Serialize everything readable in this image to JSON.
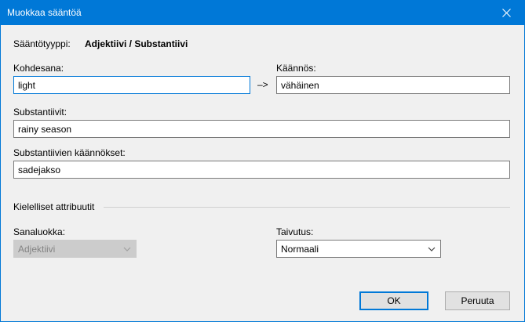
{
  "window": {
    "title": "Muokkaa sääntöä"
  },
  "rule_type": {
    "label": "Sääntötyyppi:",
    "value": "Adjektiivi / Substantiivi"
  },
  "target_word": {
    "label": "Kohdesana:",
    "value": "light"
  },
  "arrow": "–>",
  "translation": {
    "label": "Käännös:",
    "value": "vähäinen"
  },
  "nouns": {
    "label": "Substantiivit:",
    "value": "rainy season"
  },
  "noun_translations": {
    "label": "Substantiivien käännökset:",
    "value": "sadejakso"
  },
  "attributes_group": {
    "label": "Kielelliset attribuutit"
  },
  "word_class": {
    "label": "Sanaluokka:",
    "value": "Adjektiivi",
    "disabled": true
  },
  "inflection": {
    "label": "Taivutus:",
    "value": "Normaali"
  },
  "buttons": {
    "ok": "OK",
    "cancel": "Peruuta"
  },
  "colors": {
    "titlebar": "#0078d7",
    "background": "#f0f0f0",
    "focus": "#0078d7"
  },
  "icons": {
    "close": "close-icon",
    "dropdown": "chevron-down-icon"
  }
}
